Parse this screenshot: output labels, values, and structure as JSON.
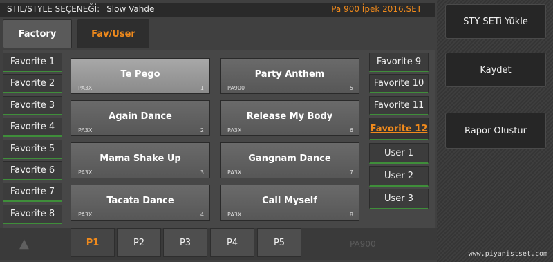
{
  "titlebar": {
    "label": "STIL/STYLE SEÇENEĞİ:",
    "style_name": "Slow Vahde",
    "file_name": "Pa 900 İpek 2016.SET"
  },
  "tabs": {
    "factory": "Factory",
    "fav_user": "Fav/User"
  },
  "left_favorites": [
    "Favorite 1",
    "Favorite 2",
    "Favorite 3",
    "Favorite 4",
    "Favorite 5",
    "Favorite 6",
    "Favorite 7",
    "Favorite 8"
  ],
  "right_banks": [
    "Favorite 9",
    "Favorite 10",
    "Favorite 11",
    "Favorite 12",
    "User 1",
    "User 2",
    "User 3"
  ],
  "slots": [
    {
      "name": "Te Pego",
      "kind": "PA3X",
      "num": "1"
    },
    {
      "name": "Party Anthem",
      "kind": "PA900",
      "num": "5"
    },
    {
      "name": "Again Dance",
      "kind": "PA3X",
      "num": "2"
    },
    {
      "name": "Release My Body",
      "kind": "PA3X",
      "num": "6"
    },
    {
      "name": "Mama Shake Up",
      "kind": "PA3X",
      "num": "3"
    },
    {
      "name": "Gangnam Dance",
      "kind": "PA3X",
      "num": "7"
    },
    {
      "name": "Tacata Dance",
      "kind": "PA3X",
      "num": "4"
    },
    {
      "name": "Call Myself",
      "kind": "PA3X",
      "num": "8"
    }
  ],
  "pages": [
    "P1",
    "P2",
    "P3",
    "P4",
    "P5"
  ],
  "model_label": "PA900",
  "sidebar": {
    "load": "STY SETi Yükle",
    "save": "Kaydet",
    "report": "Rapor Oluştur"
  },
  "footer": "www.piyanistset.com",
  "colors": {
    "accent": "#f08a1c",
    "green_line": "#3f8e3a"
  }
}
